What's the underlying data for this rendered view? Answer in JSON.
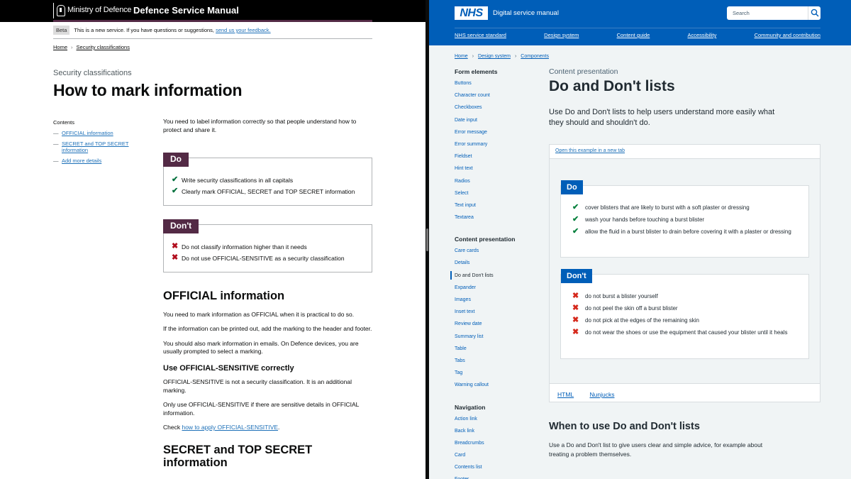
{
  "mod": {
    "org_name": "Ministry of Defence",
    "service_name": "Defence Service Manual",
    "beta": {
      "tag": "Beta",
      "text": "This is a new service. If you have questions or suggestions,",
      "link": "send us your feedback."
    },
    "breadcrumbs": [
      "Home",
      "Security classifications"
    ],
    "caption": "Security classifications",
    "title": "How to mark information",
    "contents": {
      "title": "Contents",
      "items": [
        "OFFICIAL information",
        "SECRET and TOP SECRET information",
        "Add more details"
      ]
    },
    "intro": "You need to label information correctly so that people understand how to protect and share it.",
    "do": {
      "tag": "Do",
      "items": [
        "Write security classifications in all capitals",
        "Clearly mark OFFICIAL, SECRET and TOP SECRET information"
      ]
    },
    "dont": {
      "tag": "Don't",
      "items": [
        "Do not classify information higher than it needs",
        "Do not use OFFICIAL-SENSITIVE as a security classification"
      ]
    },
    "official": {
      "heading": "OFFICIAL information",
      "p1": "You need to mark information as OFFICIAL when it is practical to do so.",
      "p2": "If the information can be printed out, add the marking to the header and footer.",
      "p3": "You should also mark information in emails. On Defence devices, you are usually prompted to select a marking."
    },
    "sensitive": {
      "heading": "Use OFFICIAL-SENSITIVE correctly",
      "p1": "OFFICIAL-SENSITIVE is not a security classification. It is an additional marking.",
      "p2": "Only use OFFICIAL-SENSITIVE if there are sensitive details in OFFICIAL information.",
      "p3_prefix": "Check ",
      "p3_link": "how to apply OFFICIAL-SENSITIVE",
      "p3_suffix": "."
    },
    "secret_heading": "SECRET and TOP SECRET information"
  },
  "nhs": {
    "logo": "NHS",
    "service_name": "Digital service manual",
    "search_placeholder": "Search",
    "nav": [
      "NHS service standard",
      "Design system",
      "Content guide",
      "Accessibility",
      "Community and contribution"
    ],
    "breadcrumbs": [
      "Home",
      "Design system",
      "Components"
    ],
    "sidebar": {
      "groups": [
        {
          "heading": "Form elements",
          "items": [
            "Buttons",
            "Character count",
            "Checkboxes",
            "Date input",
            "Error message",
            "Error summary",
            "Fieldset",
            "Hint text",
            "Radios",
            "Select",
            "Text input",
            "Textarea"
          ]
        },
        {
          "heading": "Content presentation",
          "items": [
            "Care cards",
            "Details",
            "Do and Don't lists",
            "Expander",
            "Images",
            "Inset text",
            "Review date",
            "Summary list",
            "Table",
            "Tabs",
            "Tag",
            "Warning callout"
          ]
        },
        {
          "heading": "Navigation",
          "items": [
            "Action link",
            "Back link",
            "Breadcrumbs",
            "Card",
            "Contents list",
            "Footer"
          ]
        }
      ],
      "active": "Do and Don't lists"
    },
    "caption": "Content presentation",
    "title": "Do and Don't lists",
    "lead": "Use Do and Don't lists to help users understand more easily what they should and shouldn't do.",
    "example_link": "Open this example in a new tab",
    "do": {
      "tag": "Do",
      "items": [
        "cover blisters that are likely to burst with a soft plaster or dressing",
        "wash your hands before touching a burst blister",
        "allow the fluid in a burst blister to drain before covering it with a plaster or dressing"
      ]
    },
    "dont": {
      "tag": "Don't",
      "items": [
        "do not burst a blister yourself",
        "do not peel the skin off a burst blister",
        "do not pick at the edges of the remaining skin",
        "do not wear the shoes or use the equipment that caused your blister until it heals"
      ]
    },
    "code_tabs": [
      "HTML",
      "Nunjucks"
    ],
    "when_heading": "When to use Do and Don't lists",
    "when_text": "Use a Do and Don't list to give users clear and simple advice, for example about treating a problem themselves."
  },
  "colors": {
    "mod_purple": "#532a45",
    "nhs_blue": "#005eb8",
    "tick_green": "#00703c",
    "cross_red": "#b10e1e"
  },
  "icons": {
    "tick": "check-icon",
    "cross": "cross-icon",
    "search": "search-icon"
  }
}
